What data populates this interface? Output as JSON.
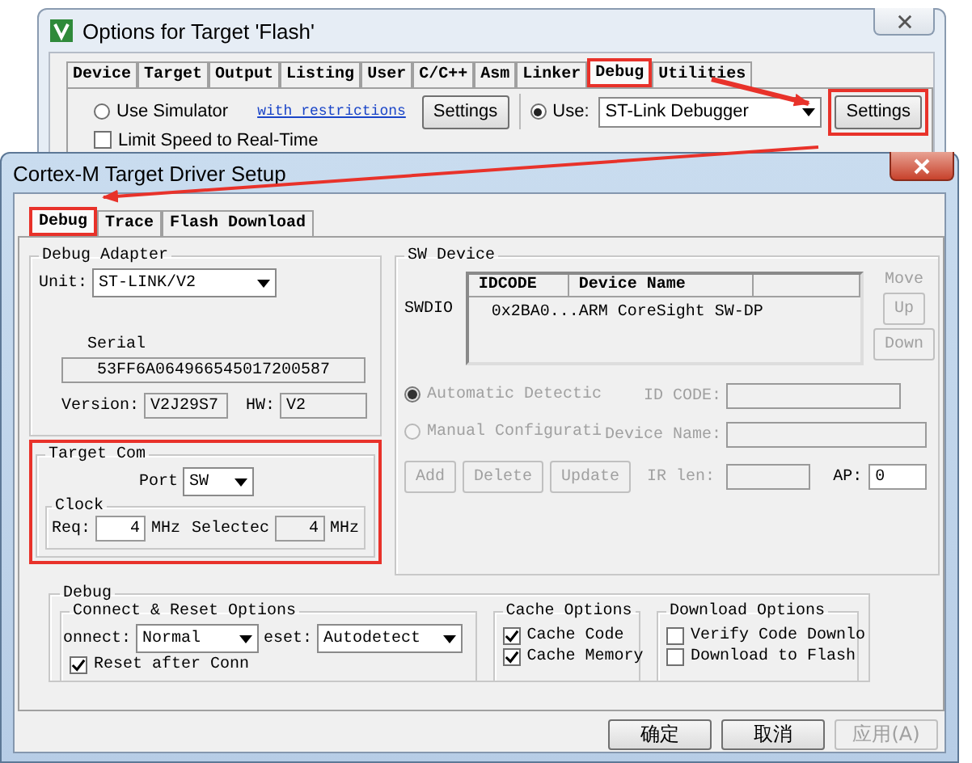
{
  "back_window": {
    "title": "Options for Target 'Flash'",
    "tabs": [
      {
        "label": "Device",
        "selected": false,
        "highlighted": false
      },
      {
        "label": "Target",
        "selected": false,
        "highlighted": false
      },
      {
        "label": "Output",
        "selected": false,
        "highlighted": false
      },
      {
        "label": "Listing",
        "selected": false,
        "highlighted": false
      },
      {
        "label": "User",
        "selected": false,
        "highlighted": false
      },
      {
        "label": "C/C++",
        "selected": false,
        "highlighted": false
      },
      {
        "label": "Asm",
        "selected": false,
        "highlighted": false
      },
      {
        "label": "Linker",
        "selected": false,
        "highlighted": false
      },
      {
        "label": "Debug",
        "selected": true,
        "highlighted": true
      },
      {
        "label": "Utilities",
        "selected": false,
        "highlighted": false
      }
    ],
    "simulator": {
      "label": "Use Simulator",
      "selected": false
    },
    "restrictions_link": "with restrictions",
    "simulator_settings": {
      "label": "Settings",
      "highlighted": false
    },
    "use_option": {
      "label": "Use:",
      "selected": true
    },
    "debugger": "ST-Link Debugger",
    "debugger_settings": {
      "label": "Settings",
      "highlighted": true
    },
    "limit_speed": {
      "label": "Limit Speed to Real-Time",
      "checked": false
    }
  },
  "dialog": {
    "title": "Cortex-M Target Driver Setup",
    "tabs": [
      {
        "label": "Debug",
        "selected": true,
        "highlighted": true
      },
      {
        "label": "Trace",
        "selected": false,
        "highlighted": false
      },
      {
        "label": "Flash Download",
        "selected": false,
        "highlighted": false
      }
    ],
    "debug_adapter": {
      "title": "Debug Adapter",
      "unit_label": "Unit:",
      "unit": "ST-LINK/V2",
      "serial_label": "Serial",
      "serial": "53FF6A064966545017200587",
      "version_label": "Version:",
      "version": "V2J29S7",
      "hw_label": "HW:",
      "hw": "V2"
    },
    "target_com": {
      "title": "Target Com",
      "highlighted": true,
      "port_label": "Port",
      "port": "SW",
      "clock_title": "Clock",
      "req_label": "Req:",
      "req": "4",
      "req_unit": "MHz",
      "selected_label": "Selectec",
      "selected_value": "4",
      "selected_unit": "MHz"
    },
    "sw_device": {
      "title": "SW Device",
      "port_label": "SWDIO",
      "columns": [
        "IDCODE",
        "Device Name"
      ],
      "rows": [
        [
          "0x2BA0...",
          "ARM CoreSight SW-DP"
        ]
      ],
      "move_label": "Move",
      "move_buttons": [
        {
          "label": "Up",
          "disabled": true
        },
        {
          "label": "Down",
          "disabled": true
        }
      ],
      "detection": [
        {
          "label": "Automatic Detectic",
          "selected": true,
          "disabled": true
        },
        {
          "label": "Manual Configurati",
          "selected": false,
          "disabled": true
        }
      ],
      "id_code_label": "ID CODE:",
      "device_name_label": "Device Name:",
      "buttons": [
        {
          "label": "Add",
          "disabled": true
        },
        {
          "label": "Delete",
          "disabled": true
        },
        {
          "label": "Update",
          "disabled": true
        }
      ],
      "ir_len_label": "IR len:",
      "ap_label": "AP:",
      "ap": "0"
    },
    "debug": {
      "title": "Debug",
      "connect_reset": {
        "title": "Connect & Reset Options",
        "connect_label": "onnect:",
        "connect": "Normal",
        "reset_label": "eset:",
        "reset": "Autodetect",
        "reset_after": {
          "label": "Reset after Conn",
          "checked": true
        }
      },
      "cache": {
        "title": "Cache Options",
        "items": [
          {
            "label": "Cache Code",
            "checked": true
          },
          {
            "label": "Cache Memory",
            "checked": true
          }
        ]
      },
      "download": {
        "title": "Download Options",
        "items": [
          {
            "label": "Verify Code Downlo",
            "checked": false
          },
          {
            "label": "Download to Flash",
            "checked": false
          }
        ]
      }
    },
    "buttons": [
      {
        "label": "确定",
        "disabled": false
      },
      {
        "label": "取消",
        "disabled": false
      },
      {
        "label": "应用(A)",
        "disabled": true
      }
    ]
  }
}
